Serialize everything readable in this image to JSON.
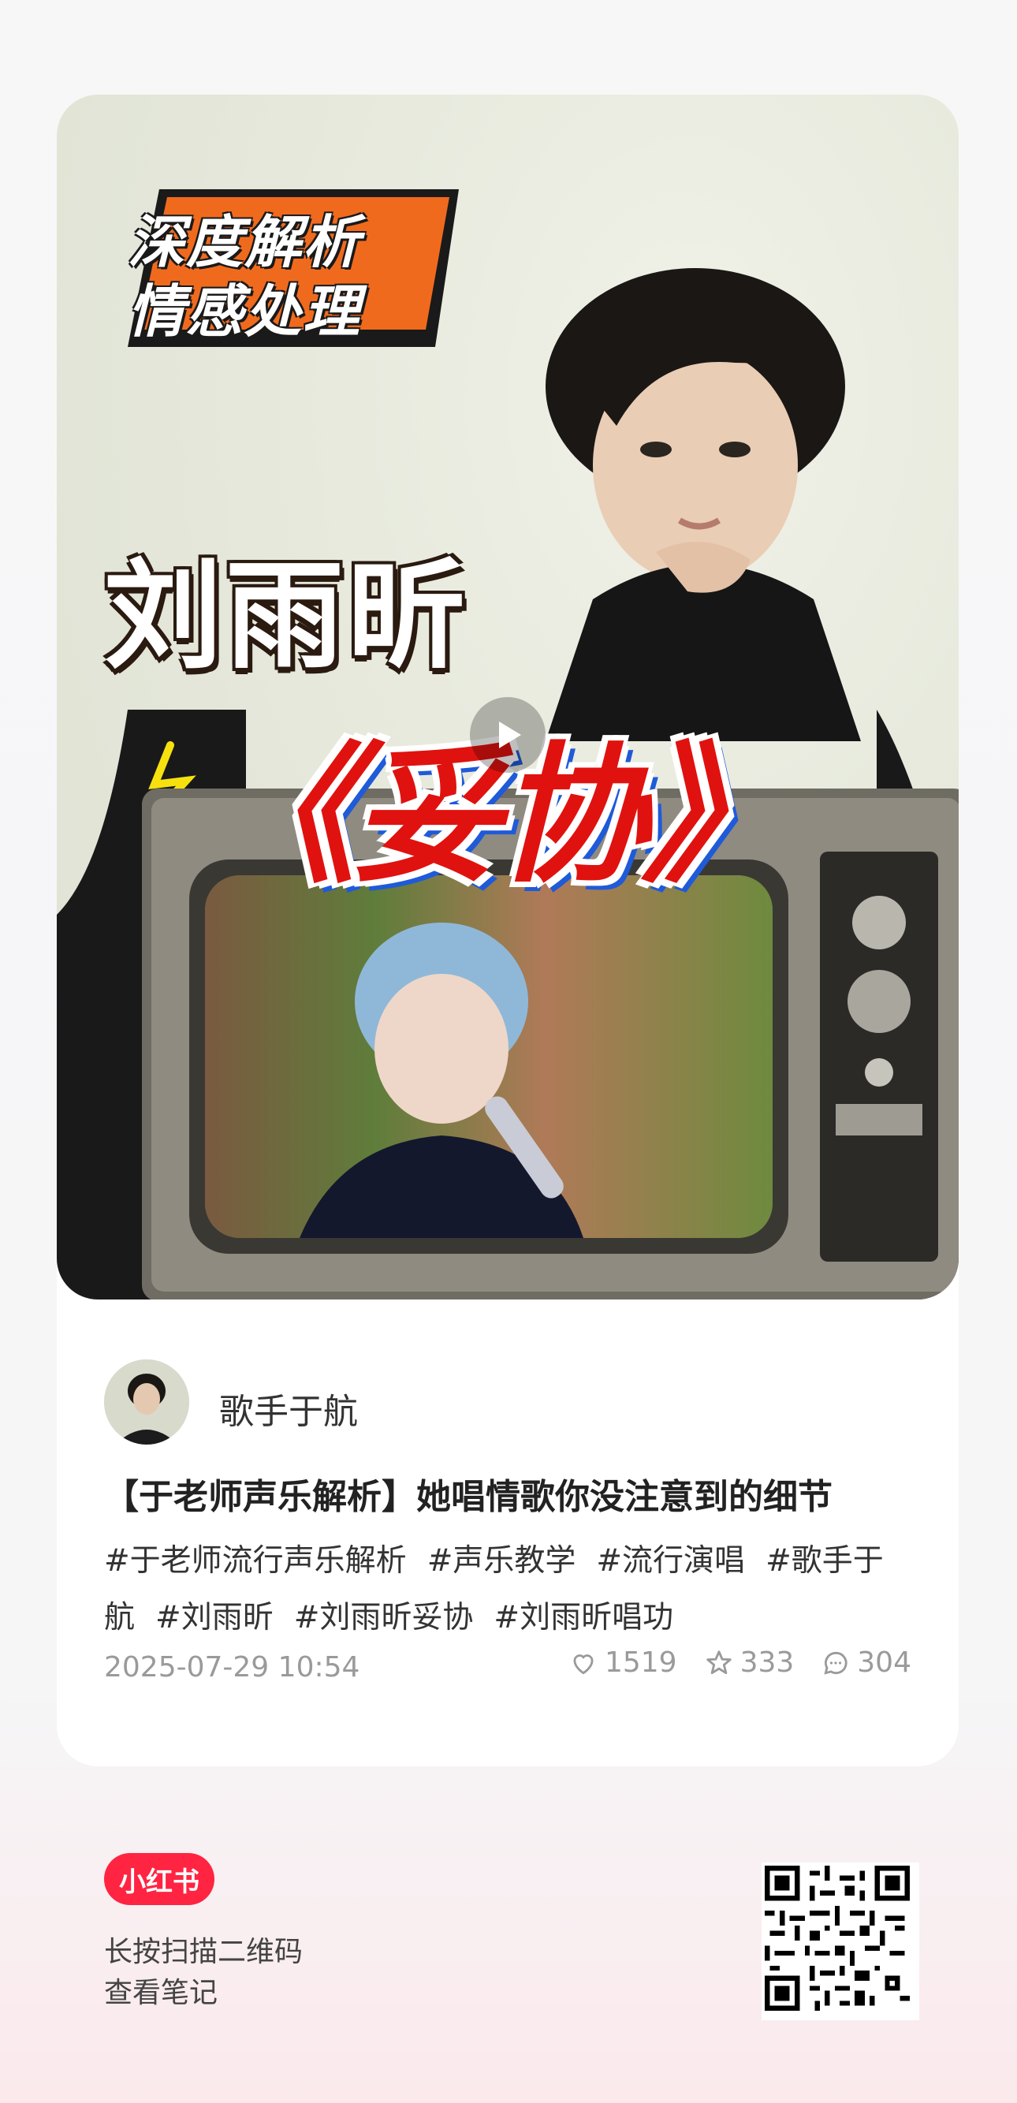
{
  "cover": {
    "badge_line1": "深度解析",
    "badge_line2": "情感处理",
    "singer_name": "刘雨昕",
    "song_title": "《妥协》"
  },
  "author": {
    "name": "歌手于航"
  },
  "note": {
    "title": "【于老师声乐解析】她唱情歌你没注意到的细节",
    "tags": [
      "#于老师流行声乐解析",
      "#声乐教学",
      "#流行演唱",
      "#歌手于航",
      "#刘雨昕",
      "#刘雨昕妥协",
      "#刘雨昕唱功"
    ],
    "date": "2025-07-29 10:54"
  },
  "stats": {
    "likes": "1519",
    "collects": "333",
    "comments": "304"
  },
  "footer": {
    "logo": "小红书",
    "hint_line1": "长按扫描二维码",
    "hint_line2": "查看笔记"
  },
  "colors": {
    "brand": "#ff2442",
    "song_title_red": "#e0120f",
    "song_title_blue": "#1f5ad8",
    "badge_orange": "#f06a1e"
  }
}
